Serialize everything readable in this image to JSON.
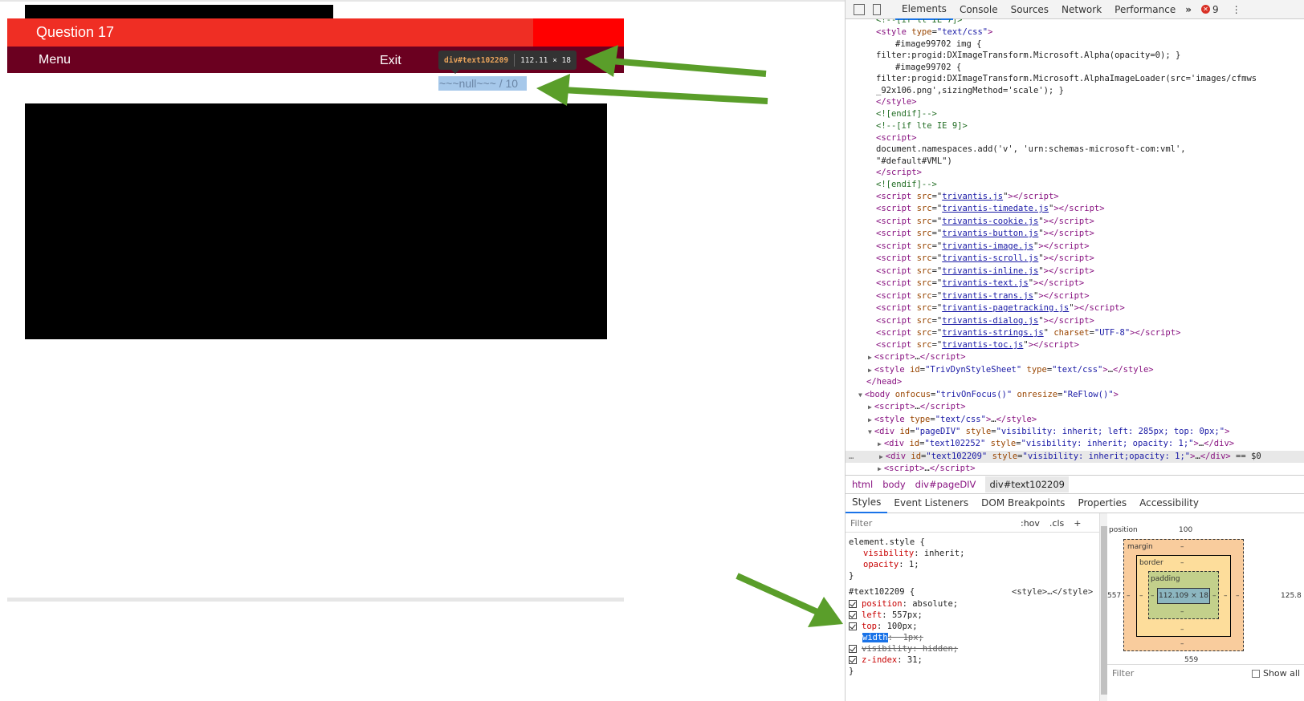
{
  "page": {
    "question_title": "Question 17",
    "menu_label": "Menu",
    "exit_label": "Exit",
    "score_text": "~~~null~~~ / 10",
    "tooltip": {
      "name": "div#text102209",
      "size": "112.11 × 18"
    }
  },
  "devtools": {
    "tabs": [
      "Elements",
      "Console",
      "Sources",
      "Network",
      "Performance"
    ],
    "active_tab": "Elements",
    "more": "»",
    "error_count": "9",
    "kebab": "⋮",
    "breadcrumbs": [
      "html",
      "body",
      "div#pageDIV",
      "div#text102209"
    ],
    "sub_tabs": [
      "Styles",
      "Event Listeners",
      "DOM Breakpoints",
      "Properties",
      "Accessibility"
    ],
    "filter_placeholder": "Filter",
    "hov": ":hov",
    "cls": ".cls",
    "plus": "+",
    "boxmodel": {
      "position_label": "position",
      "position_value": "100",
      "margin_label": "margin",
      "border_label": "border",
      "padding_label": "padding",
      "content_size": "112.109 × 18",
      "dash": "–",
      "left_value": "557",
      "right_value": "125.8",
      "bottom_value": "559",
      "filter_placeholder": "Filter",
      "show_all": "Show all"
    },
    "style_source": "<style>…</style>",
    "colors": {
      "question_bar": "#ef2e24",
      "menu_bar": "#6b0020",
      "selection": "#a6c8ea",
      "annotation_arrow": "#5a9e2a"
    }
  }
}
